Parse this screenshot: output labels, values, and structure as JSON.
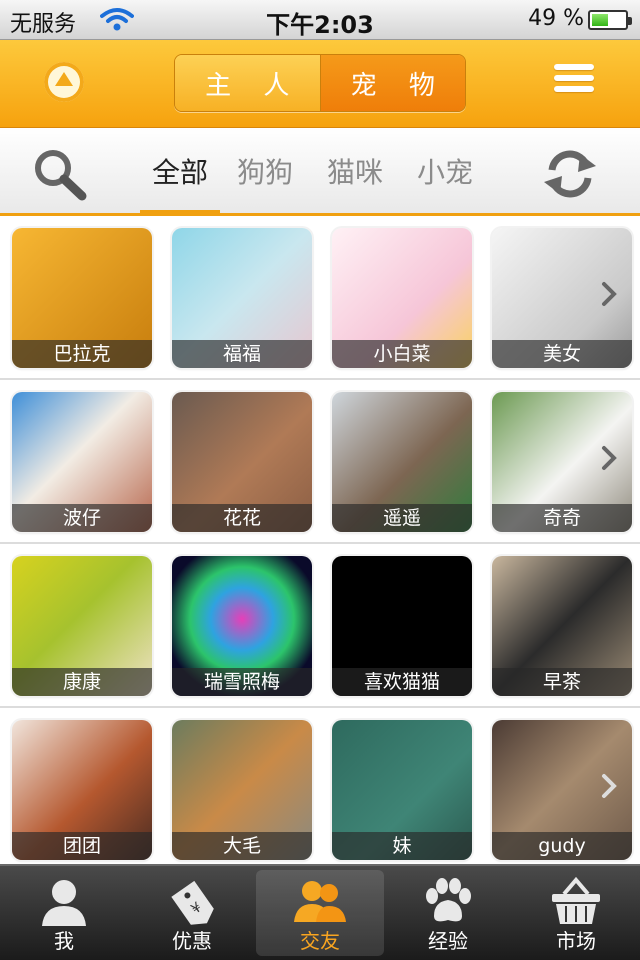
{
  "status_bar": {
    "carrier": "无服务",
    "time": "下午2:03",
    "battery_percent": "49 %",
    "battery_level": 0.49
  },
  "header": {
    "segments": [
      {
        "label": "主 人",
        "selected": false
      },
      {
        "label": "宠 物",
        "selected": true
      }
    ]
  },
  "categories": {
    "tabs": [
      {
        "label": "全部",
        "active": true
      },
      {
        "label": "狗狗",
        "active": false
      },
      {
        "label": "猫咪",
        "active": false
      },
      {
        "label": "小宠",
        "active": false
      }
    ]
  },
  "pets": [
    [
      {
        "name": "巴拉克",
        "bg": "linear-gradient(135deg,#f7b733,#c77d0d)"
      },
      {
        "name": "福福",
        "bg": "linear-gradient(135deg,#8fd6e8,#c9e7ef 50%,#e7c6cf)"
      },
      {
        "name": "小白菜",
        "bg": "linear-gradient(135deg,#fff1f5,#f6c6d8 60%,#f9d25d)"
      },
      {
        "name": "美女",
        "bg": "linear-gradient(135deg,#f5f5f5,#c9c9c9 70%,#9a9a9a)"
      }
    ],
    [
      {
        "name": "波仔",
        "bg": "linear-gradient(135deg,#3f8fd8,#f2ece4 45%,#b7664c)"
      },
      {
        "name": "花花",
        "bg": "linear-gradient(135deg,#6a5a50,#b07a56 55%,#8b5e44)"
      },
      {
        "name": "遥遥",
        "bg": "linear-gradient(135deg,#cfd6dc,#7d6652 55%,#2e7d3d)"
      },
      {
        "name": "奇奇",
        "bg": "linear-gradient(135deg,#6c9a52,#f4f4f2 55%,#8f8a7d)"
      }
    ],
    [
      {
        "name": "康康",
        "bg": "linear-gradient(135deg,#d7d21f,#a6c22e 45%,#efe2c7)"
      },
      {
        "name": "瑞雪照梅",
        "bg": "radial-gradient(circle at 50% 45%,#e63fb9,#2ea3e0 30%,#2cc46b 50%,#0a0a2a 75%)"
      },
      {
        "name": "喜欢猫猫",
        "bg": "#000000"
      },
      {
        "name": "早茶",
        "bg": "linear-gradient(135deg,#c9b79e,#2b2b2b 50%,#9b8b75)"
      }
    ],
    [
      {
        "name": "团团",
        "bg": "linear-gradient(135deg,#f1e5dc,#b5582f 55%,#4a2c22)"
      },
      {
        "name": "大毛",
        "bg": "linear-gradient(135deg,#6c7c5e,#c98a48 50%,#8a8a80)"
      },
      {
        "name": "妹",
        "bg": "linear-gradient(135deg,#2e6a5e,#3f8576 60%,#2b5a50)"
      },
      {
        "name": "gudy",
        "bg": "linear-gradient(135deg,#4b3b34,#a58a6e 50%,#6e5a4a)"
      }
    ]
  ],
  "tab_bar": [
    {
      "label": "我",
      "icon": "person-icon",
      "active": false
    },
    {
      "label": "优惠",
      "icon": "discount-tag-icon",
      "active": false
    },
    {
      "label": "交友",
      "icon": "friends-icon",
      "active": true
    },
    {
      "label": "经验",
      "icon": "paw-icon",
      "active": false
    },
    {
      "label": "市场",
      "icon": "basket-icon",
      "active": false
    }
  ],
  "colors": {
    "accent": "#f6a20e",
    "active_tab": "#f9a520"
  }
}
